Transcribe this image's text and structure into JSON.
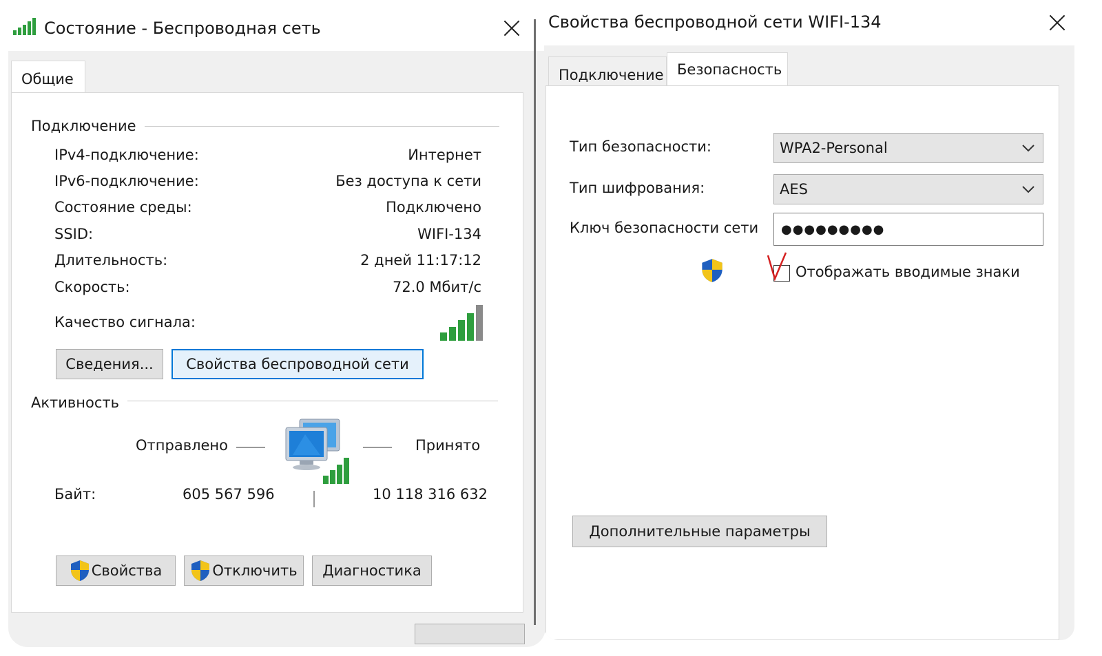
{
  "left_window": {
    "title": "Состояние - Беспроводная сеть",
    "tab_general": "Общие",
    "connection_group": "Подключение",
    "rows": [
      {
        "label": "IPv4-подключение:",
        "value": "Интернет"
      },
      {
        "label": "IPv6-подключение:",
        "value": "Без доступа к сети"
      },
      {
        "label": "Состояние среды:",
        "value": "Подключено"
      },
      {
        "label": "SSID:",
        "value": "WIFI-134"
      },
      {
        "label": "Длительность:",
        "value": "2 дней 11:17:12"
      },
      {
        "label": "Скорость:",
        "value": "72.0 Мбит/с"
      }
    ],
    "signal_label": "Качество сигнала:",
    "signal_bars": 5,
    "details_button": "Сведения...",
    "wireless_props_button": "Свойства беспроводной сети",
    "activity_group": "Активность",
    "sent_label": "Отправлено",
    "received_label": "Принято",
    "bytes_label": "Байт:",
    "bytes_sent": "605 567 596",
    "bytes_received": "10 118 316 632",
    "properties_button": "Свойства",
    "disconnect_button": "Отключить",
    "diagnostics_button": "Диагностика"
  },
  "right_window": {
    "title": "Свойства беспроводной сети WIFI-134",
    "tab_connection": "Подключение",
    "tab_security": "Безопасность",
    "security_type_label": "Тип безопасности:",
    "security_type_value": "WPA2-Personal",
    "encryption_type_label": "Тип шифрования:",
    "encryption_type_value": "AES",
    "network_key_label": "Ключ безопасности сети",
    "network_key_value": "●●●●●●●●●",
    "show_chars_label": "Отображать вводимые знаки",
    "show_chars_checked": false,
    "advanced_button": "Дополнительные параметры"
  },
  "colors": {
    "accent_blue": "#0078d7",
    "signal_green": "#2e9e3e",
    "annotation_red": "#d42020",
    "shield_blue": "#1f5fbf",
    "shield_yellow": "#f2c419"
  },
  "icons": {
    "title_icon": "wifi-signal-icon",
    "close": "close-icon",
    "shield": "uac-shield-icon",
    "dropdown": "chevron-down-icon",
    "network": "network-computers-icon"
  }
}
